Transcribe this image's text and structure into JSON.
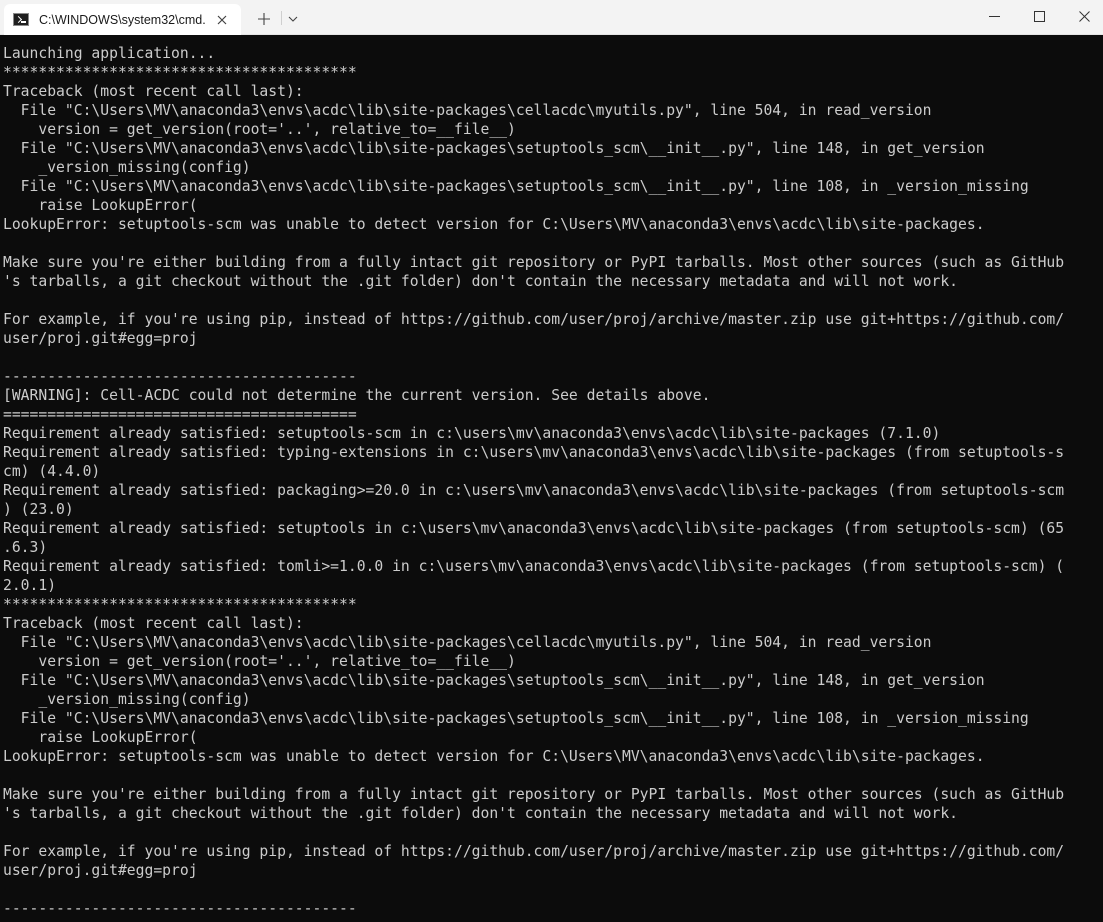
{
  "window": {
    "tab_title": "C:\\WINDOWS\\system32\\cmd.",
    "tab_icon": "console-icon"
  },
  "console": {
    "lines": [
      "Launching application...",
      "****************************************",
      "Traceback (most recent call last):",
      "  File \"C:\\Users\\MV\\anaconda3\\envs\\acdc\\lib\\site-packages\\cellacdc\\myutils.py\", line 504, in read_version",
      "    version = get_version(root='..', relative_to=__file__)",
      "  File \"C:\\Users\\MV\\anaconda3\\envs\\acdc\\lib\\site-packages\\setuptools_scm\\__init__.py\", line 148, in get_version",
      "    _version_missing(config)",
      "  File \"C:\\Users\\MV\\anaconda3\\envs\\acdc\\lib\\site-packages\\setuptools_scm\\__init__.py\", line 108, in _version_missing",
      "    raise LookupError(",
      "LookupError: setuptools-scm was unable to detect version for C:\\Users\\MV\\anaconda3\\envs\\acdc\\lib\\site-packages.",
      "",
      "Make sure you're either building from a fully intact git repository or PyPI tarballs. Most other sources (such as GitHub",
      "'s tarballs, a git checkout without the .git folder) don't contain the necessary metadata and will not work.",
      "",
      "For example, if you're using pip, instead of https://github.com/user/proj/archive/master.zip use git+https://github.com/",
      "user/proj.git#egg=proj",
      "",
      "----------------------------------------",
      "[WARNING]: Cell-ACDC could not determine the current version. See details above.",
      "========================================",
      "Requirement already satisfied: setuptools-scm in c:\\users\\mv\\anaconda3\\envs\\acdc\\lib\\site-packages (7.1.0)",
      "Requirement already satisfied: typing-extensions in c:\\users\\mv\\anaconda3\\envs\\acdc\\lib\\site-packages (from setuptools-s",
      "cm) (4.4.0)",
      "Requirement already satisfied: packaging>=20.0 in c:\\users\\mv\\anaconda3\\envs\\acdc\\lib\\site-packages (from setuptools-scm",
      ") (23.0)",
      "Requirement already satisfied: setuptools in c:\\users\\mv\\anaconda3\\envs\\acdc\\lib\\site-packages (from setuptools-scm) (65",
      ".6.3)",
      "Requirement already satisfied: tomli>=1.0.0 in c:\\users\\mv\\anaconda3\\envs\\acdc\\lib\\site-packages (from setuptools-scm) (",
      "2.0.1)",
      "****************************************",
      "Traceback (most recent call last):",
      "  File \"C:\\Users\\MV\\anaconda3\\envs\\acdc\\lib\\site-packages\\cellacdc\\myutils.py\", line 504, in read_version",
      "    version = get_version(root='..', relative_to=__file__)",
      "  File \"C:\\Users\\MV\\anaconda3\\envs\\acdc\\lib\\site-packages\\setuptools_scm\\__init__.py\", line 148, in get_version",
      "    _version_missing(config)",
      "  File \"C:\\Users\\MV\\anaconda3\\envs\\acdc\\lib\\site-packages\\setuptools_scm\\__init__.py\", line 108, in _version_missing",
      "    raise LookupError(",
      "LookupError: setuptools-scm was unable to detect version for C:\\Users\\MV\\anaconda3\\envs\\acdc\\lib\\site-packages.",
      "",
      "Make sure you're either building from a fully intact git repository or PyPI tarballs. Most other sources (such as GitHub",
      "'s tarballs, a git checkout without the .git folder) don't contain the necessary metadata and will not work.",
      "",
      "For example, if you're using pip, instead of https://github.com/user/proj/archive/master.zip use git+https://github.com/",
      "user/proj.git#egg=proj",
      "",
      "----------------------------------------"
    ]
  },
  "colors": {
    "terminal_bg": "#0c0c0c",
    "terminal_fg": "#cccccc",
    "titlebar_bg": "#f3f3f3",
    "tab_bg": "#ffffff"
  }
}
